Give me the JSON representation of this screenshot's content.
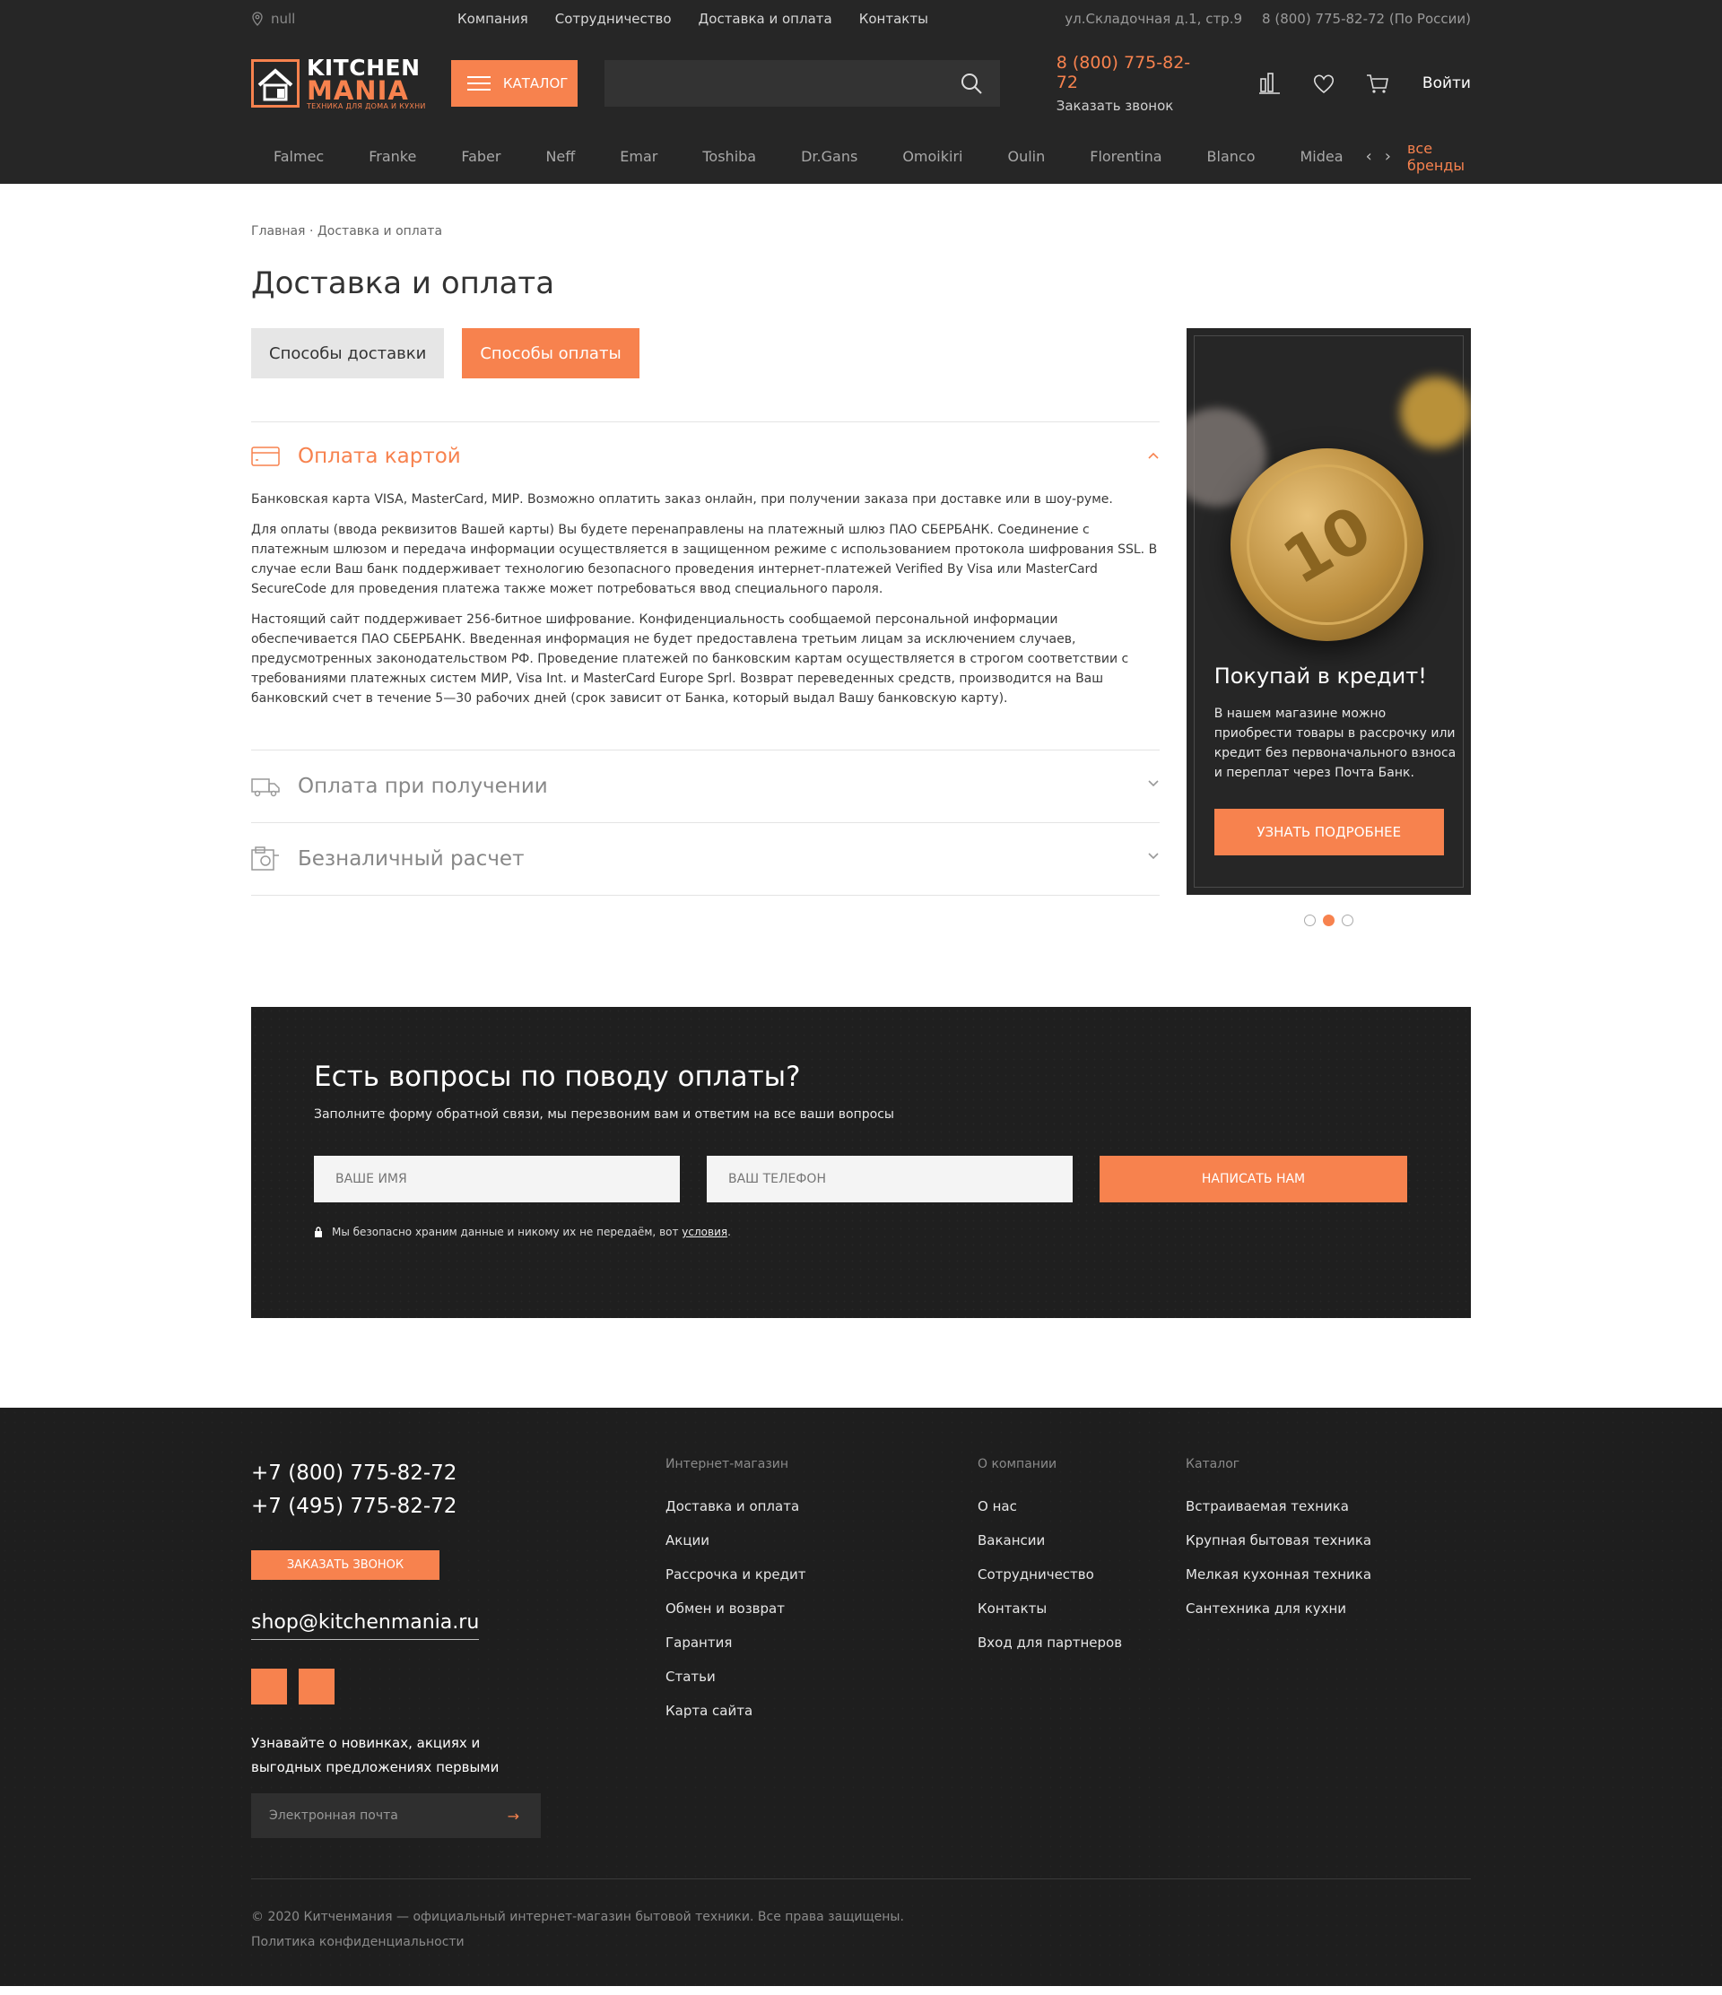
{
  "topbar": {
    "city": "null",
    "nav": [
      "Компания",
      "Сотрудничество",
      "Доставка и оплата",
      "Контакты"
    ],
    "address": "ул.Складочная д.1, стр.9",
    "phone": "8 (800) 775-82-72 (По России)"
  },
  "logo": {
    "line1": "KITCHEN",
    "line2": "MANIA",
    "tagline": "ТЕХНИКА ДЛЯ ДОМА И КУХНИ"
  },
  "catalog_label": "КАТАЛОГ",
  "search": {
    "placeholder": ""
  },
  "contact": {
    "phone": "8 (800) 775-82-72",
    "callback": "Заказать звонок"
  },
  "icons": [
    "compare-icon",
    "heart-icon",
    "cart-icon"
  ],
  "login_label": "Войти",
  "brands": [
    "Falmec",
    "Franke",
    "Faber",
    "Neff",
    "Emar",
    "Toshiba",
    "Dr.Gans",
    "Omoikiri",
    "Oulin",
    "Florentina",
    "Blanco",
    "Midea"
  ],
  "brands_prev": "‹",
  "brands_next": "›",
  "brands_all": "все бренды",
  "breadcrumbs": {
    "home": "Главная",
    "separator": "·",
    "current": "Доставка и оплата"
  },
  "page_title": "Доставка и оплата",
  "tabs": [
    {
      "label": "Способы доставки"
    },
    {
      "label": "Способы оплаты"
    }
  ],
  "accordion": [
    {
      "title": "Оплата картой",
      "paragraphs": [
        "Банковская карта VISA, MasterCard, МИР. Возможно оплатить заказ онлайн, при получении заказа при доставке или в шоу-руме.",
        "Для оплаты (ввода реквизитов Вашей карты) Вы будете перенаправлены на платежный шлюз ПАО СБЕРБАНК. Соединение с платежным шлюзом и передача информации осуществляется в защищенном режиме с использованием протокола шифрования SSL. В случае если Ваш банк поддерживает технологию безопасного проведения интернет-платежей Verified By Visa или MasterCard SecureCode для проведения платежа также может потребоваться ввод специального пароля.",
        "Настоящий сайт поддерживает 256-битное шифрование. Конфиденциальность сообщаемой персональной информации обеспечивается ПАО СБЕРБАНК. Введенная информация не будет предоставлена третьим лицам за исключением случаев, предусмотренных законодательством РФ. Проведение платежей по банковским картам осуществляется в строгом соответствии с требованиями платежных систем МИР, Visa Int. и MasterCard Europe Sprl. Возврат переведенных средств, производится на Ваш банковский счет в течение 5—30 рабочих дней (срок зависит от Банка, который выдал Вашу банковскую карту)."
      ]
    },
    {
      "title": "Оплата при получении"
    },
    {
      "title": "Безналичный расчет"
    }
  ],
  "promo": {
    "coin_value": "10",
    "title": "Покупай в кредит!",
    "text": "В нашем магазине можно приобрести товары в рассрочку или кредит без первоначального взноса и переплат через Почта Банк.",
    "button": "УЗНАТЬ ПОДРОБНЕЕ",
    "slides": 3,
    "active_slide": 2
  },
  "questions": {
    "title": "Есть вопросы по поводу оплаты?",
    "subtitle": "Заполните форму обратной связи, мы перезвоним вам и ответим на все ваши вопросы",
    "name_placeholder": "ВАШЕ ИМЯ",
    "phone_placeholder": "ВАШ ТЕЛЕФОН",
    "button": "НАПИСАТЬ НАМ",
    "note": "Мы безопасно храним данные и никому их не передаём, вот",
    "note_link": "условия",
    "note_end": "."
  },
  "footer": {
    "phones": [
      "+7 (800) 775-82-72",
      "+7 (495) 775-82-72"
    ],
    "callback": "ЗАКАЗАТЬ ЗВОНОК",
    "email": "shop@kitchenmania.ru",
    "subscribe_text": "Узнавайте о новинках, акциях и выгодных предложениях первыми",
    "email_placeholder": "Электронная почта",
    "columns": [
      {
        "heading": "Интернет-магазин",
        "links": [
          "Доставка и оплата",
          "Акции",
          "Рассрочка и кредит",
          "Обмен и возврат",
          "Гарантия",
          "Статьи",
          "Карта сайта"
        ]
      },
      {
        "heading": "О компании",
        "links": [
          "О нас",
          "Вакансии",
          "Сотрудничество",
          "Контакты",
          "Вход для партнеров"
        ]
      },
      {
        "heading": "Каталог",
        "links": [
          "Встраиваемая техника",
          "Крупная бытовая техника",
          "Мелкая кухонная техника",
          "Сантехника для кухни"
        ]
      }
    ],
    "copyright": "© 2020 Китченмания — официальный интернет-магазин бытовой техники. Все права защищены.",
    "privacy": "Политика конфиденциальности"
  },
  "colors": {
    "accent": "#f7824e",
    "header_bg": "#262626",
    "dark_bg": "#1f1f1f"
  }
}
